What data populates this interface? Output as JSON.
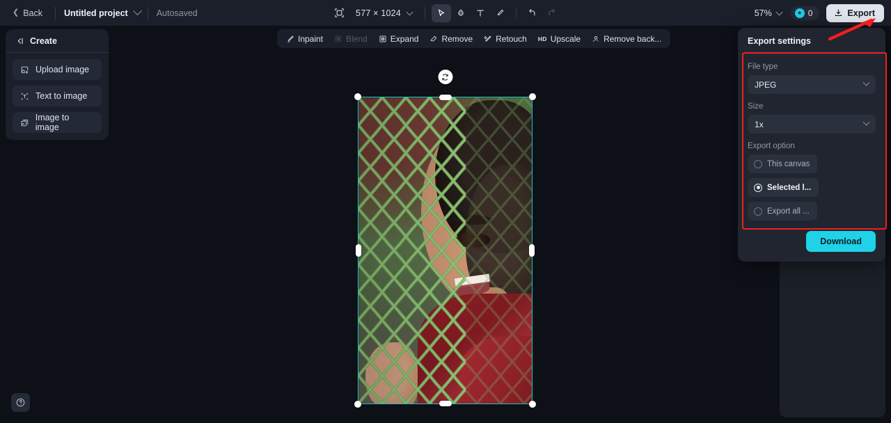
{
  "topbar": {
    "back_label": "Back",
    "project_name": "Untitled project",
    "autosave_status": "Autosaved",
    "canvas_size": "577 × 1024",
    "zoom_level": "57%",
    "credits_count": "0",
    "export_label": "Export",
    "tools": [
      {
        "name": "frame-size-icon",
        "title": "Canvas size"
      },
      {
        "name": "select-tool",
        "title": "Select",
        "active": true
      },
      {
        "name": "fill-tool",
        "title": "Fill"
      },
      {
        "name": "text-tool",
        "title": "Text"
      },
      {
        "name": "brush-tool",
        "title": "Brush"
      },
      {
        "name": "undo-tool",
        "title": "Undo"
      },
      {
        "name": "redo-tool",
        "title": "Redo",
        "disabled": true
      }
    ]
  },
  "sidebar": {
    "header": "Create",
    "items": [
      {
        "label": "Upload image",
        "icon": "upload-image-icon"
      },
      {
        "label": "Text to image",
        "icon": "text-to-image-icon"
      },
      {
        "label": "Image to image",
        "icon": "image-to-image-icon"
      }
    ]
  },
  "canvas_toolbar": {
    "items": [
      {
        "label": "Inpaint",
        "icon": "inpaint-icon",
        "disabled": false
      },
      {
        "label": "Blend",
        "icon": "blend-icon",
        "disabled": true
      },
      {
        "label": "Expand",
        "icon": "expand-icon",
        "disabled": false
      },
      {
        "label": "Remove",
        "icon": "remove-icon",
        "disabled": false
      },
      {
        "label": "Retouch",
        "icon": "retouch-icon",
        "disabled": false
      },
      {
        "label": "Upscale",
        "icon": "upscale-icon",
        "badge": "HD",
        "disabled": false
      },
      {
        "label": "Remove back...",
        "icon": "remove-background-icon",
        "disabled": false
      }
    ]
  },
  "export_panel": {
    "title": "Export settings",
    "file_type_label": "File type",
    "file_type_value": "JPEG",
    "size_label": "Size",
    "size_value": "1x",
    "export_option_label": "Export option",
    "options": [
      {
        "label": "This canvas",
        "selected": false
      },
      {
        "label": "Selected l...",
        "selected": true
      },
      {
        "label": "Export all ...",
        "selected": false
      }
    ],
    "download_label": "Download"
  },
  "help": {
    "label": "?"
  },
  "colors": {
    "accent_cyan": "#1fd2e8",
    "selection_teal": "#19c6c0",
    "annotation_red": "#f51d1d",
    "panel_bg": "#20252f",
    "app_bg": "#0d1017",
    "topbar_bg": "#1b1f2a"
  }
}
